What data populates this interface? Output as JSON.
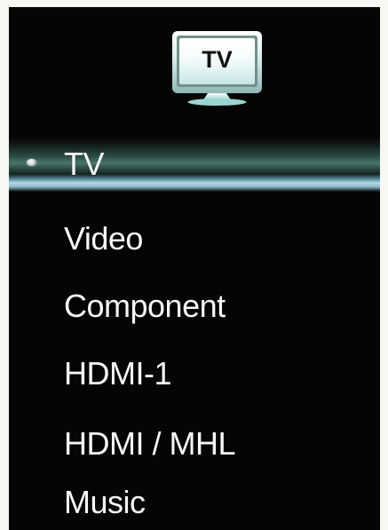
{
  "header": {
    "icon_name": "tv-icon",
    "icon_label": "TV"
  },
  "menu": {
    "selected_index": 0,
    "items": [
      {
        "label": "TV",
        "icon": "selection-bullet-icon"
      },
      {
        "label": "Video"
      },
      {
        "label": "Component"
      },
      {
        "label": "HDMI-1"
      },
      {
        "label": "HDMI / MHL"
      },
      {
        "label": "Music"
      }
    ]
  },
  "colors": {
    "panel_background": "#050505",
    "page_background": "#f8f8f2",
    "text": "#f7f7f7",
    "selection_highlight": "#b8d9e4",
    "selection_band": "#4a756b"
  }
}
